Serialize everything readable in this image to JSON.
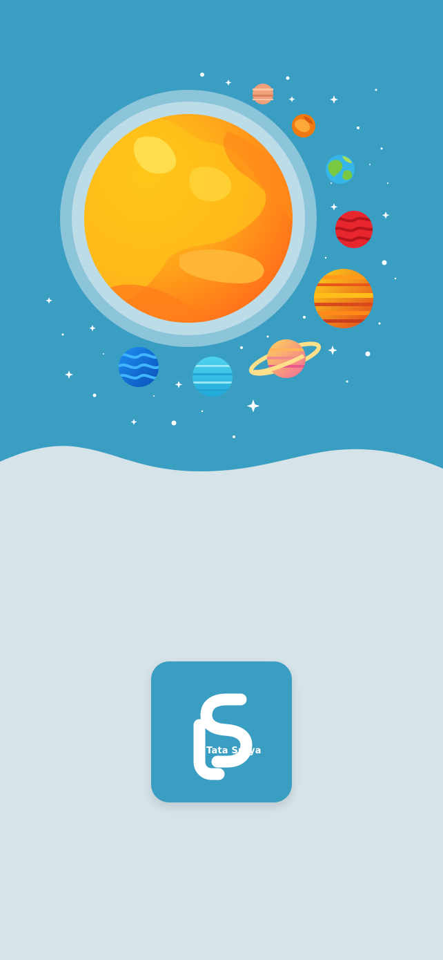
{
  "splash": {
    "app_name": "Tata Surya",
    "colors": {
      "sky": "#3a9ec2",
      "ground": "#d6e4ea",
      "logo_bg": "#3a9ec2",
      "logo_fg": "#ffffff"
    },
    "illustration": {
      "sun_icon": "sun-icon",
      "planets": [
        "mercury",
        "venus",
        "earth",
        "mars",
        "jupiter",
        "saturn",
        "uranus",
        "neptune"
      ]
    }
  }
}
